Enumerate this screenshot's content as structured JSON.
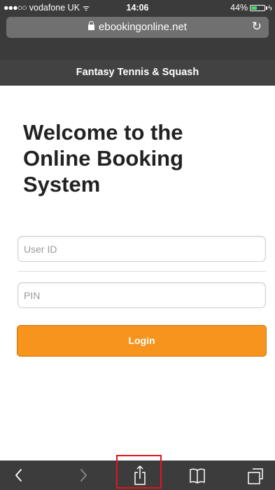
{
  "status_bar": {
    "carrier": "vodafone UK",
    "time": "14:06",
    "battery": "44%",
    "battery_level": 0.44
  },
  "browser": {
    "url": "ebookingonline.net"
  },
  "site": {
    "header_title": "Fantasy Tennis & Squash"
  },
  "page": {
    "heading": "Welcome to the Online Booking System"
  },
  "form": {
    "user_id_placeholder": "User ID",
    "pin_placeholder": "PIN",
    "user_id_value": "",
    "pin_value": "",
    "login_label": "Login"
  },
  "colors": {
    "accent": "#f7941d",
    "header_bg": "#424242",
    "highlight": "#e3141c"
  },
  "toolbar": {
    "icons": [
      "chevron-left-icon",
      "chevron-right-icon",
      "share-icon",
      "bookmarks-icon",
      "tabs-icon"
    ]
  }
}
